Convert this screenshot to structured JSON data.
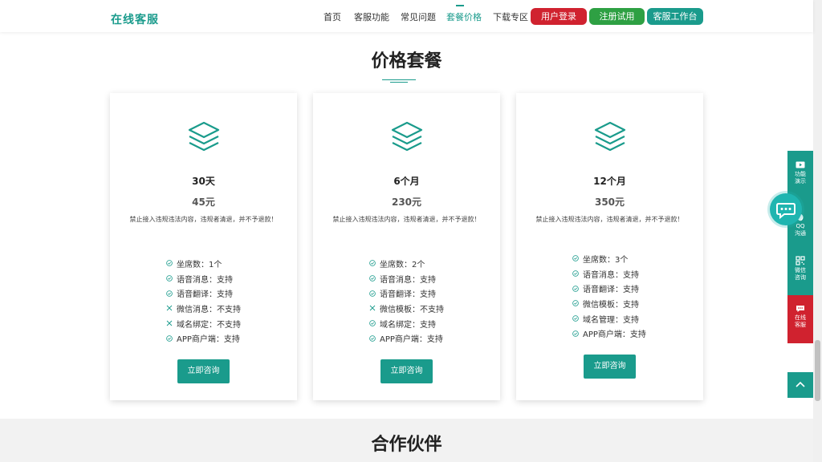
{
  "header": {
    "logo": "在线客服",
    "nav": [
      "首页",
      "客服功能",
      "常见问题",
      "套餐价格",
      "下载专区"
    ],
    "active_nav": "套餐价格",
    "buttons": {
      "login": "用户登录",
      "register": "注册试用",
      "workspace": "客服工作台"
    }
  },
  "pricing": {
    "title": "价格套餐",
    "plans": [
      {
        "name": "30天",
        "price": "45元",
        "desc": "禁止接入违规违法内容，违规者清退，并不予退款！",
        "features": [
          {
            "text": "坐席数：1个",
            "ok": true
          },
          {
            "text": "语音消息：支持",
            "ok": true
          },
          {
            "text": "语音翻译：支持",
            "ok": true
          },
          {
            "text": "微信消息：不支持",
            "ok": false
          },
          {
            "text": "域名绑定：不支持",
            "ok": false
          },
          {
            "text": "APP商户端：支持",
            "ok": true
          }
        ],
        "button": "立即咨询"
      },
      {
        "name": "6个月",
        "price": "230元",
        "desc": "禁止接入违规违法内容，违规者清退，并不予退款！",
        "features": [
          {
            "text": "坐席数：2个",
            "ok": true
          },
          {
            "text": "语音消息：支持",
            "ok": true
          },
          {
            "text": "语音翻译：支持",
            "ok": true
          },
          {
            "text": "微信模板：不支持",
            "ok": false
          },
          {
            "text": "域名绑定：支持",
            "ok": true
          },
          {
            "text": "APP商户端：支持",
            "ok": true
          }
        ],
        "button": "立即咨询"
      },
      {
        "name": "12个月",
        "price": "350元",
        "desc": "禁止接入违规违法内容，违规者清退，并不予退款！",
        "features": [
          {
            "text": "坐席数：3个",
            "ok": true
          },
          {
            "text": "语音消息：支持",
            "ok": true
          },
          {
            "text": "语音翻译：支持",
            "ok": true
          },
          {
            "text": "微信模板：支持",
            "ok": true
          },
          {
            "text": "域名管理：支持",
            "ok": true
          },
          {
            "text": "APP商户端：支持",
            "ok": true
          }
        ],
        "button": "立即咨询"
      }
    ]
  },
  "partners": {
    "title": "合作伙伴"
  },
  "side_bar": {
    "demo": [
      "功能",
      "演示"
    ],
    "qq": [
      "QQ",
      "沟通"
    ],
    "wechat": [
      "微信",
      "咨询"
    ],
    "online": [
      "在线",
      "客服"
    ]
  },
  "colors": {
    "brand_teal": "#1a9b8c",
    "red": "#d0222f",
    "green": "#2ea043"
  }
}
